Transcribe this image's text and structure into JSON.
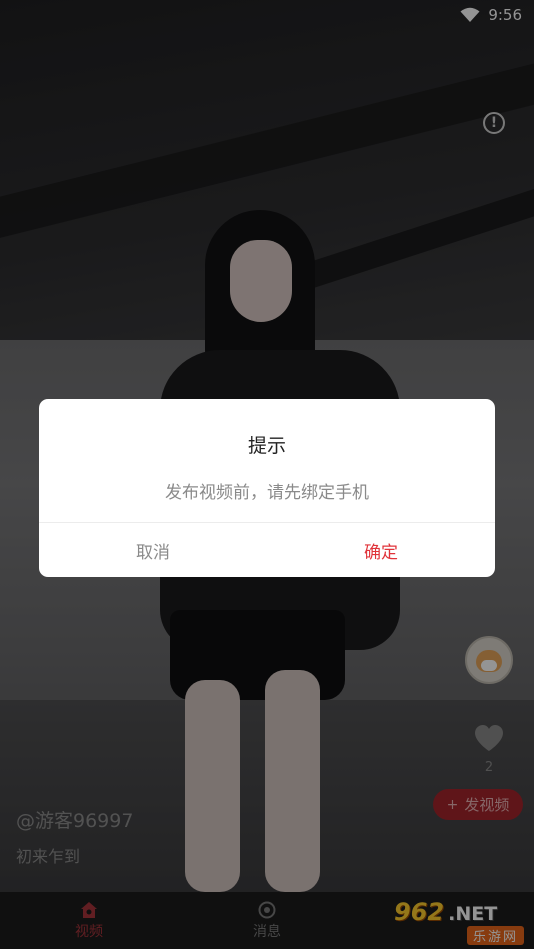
{
  "status_bar": {
    "time": "9:56"
  },
  "dialog": {
    "title": "提示",
    "message": "发布视频前，请先绑定手机",
    "cancel_label": "取消",
    "confirm_label": "确定"
  },
  "video": {
    "username": "@游客96997",
    "caption": "初来乍到",
    "like_count": "2"
  },
  "side_actions": {
    "publish_label": "发视频",
    "publish_icon": "+"
  },
  "bottom_nav": {
    "items": [
      {
        "label": "视频",
        "icon": "home-icon",
        "active": true
      },
      {
        "label": "消息",
        "icon": "message-icon",
        "active": false
      }
    ]
  },
  "watermark": {
    "number": "962",
    "suffix": ".NET",
    "site_name": "乐游网"
  },
  "colors": {
    "accent": "#e0333a",
    "nav_active": "#a8353b",
    "publish_bg": "#a4252c"
  }
}
